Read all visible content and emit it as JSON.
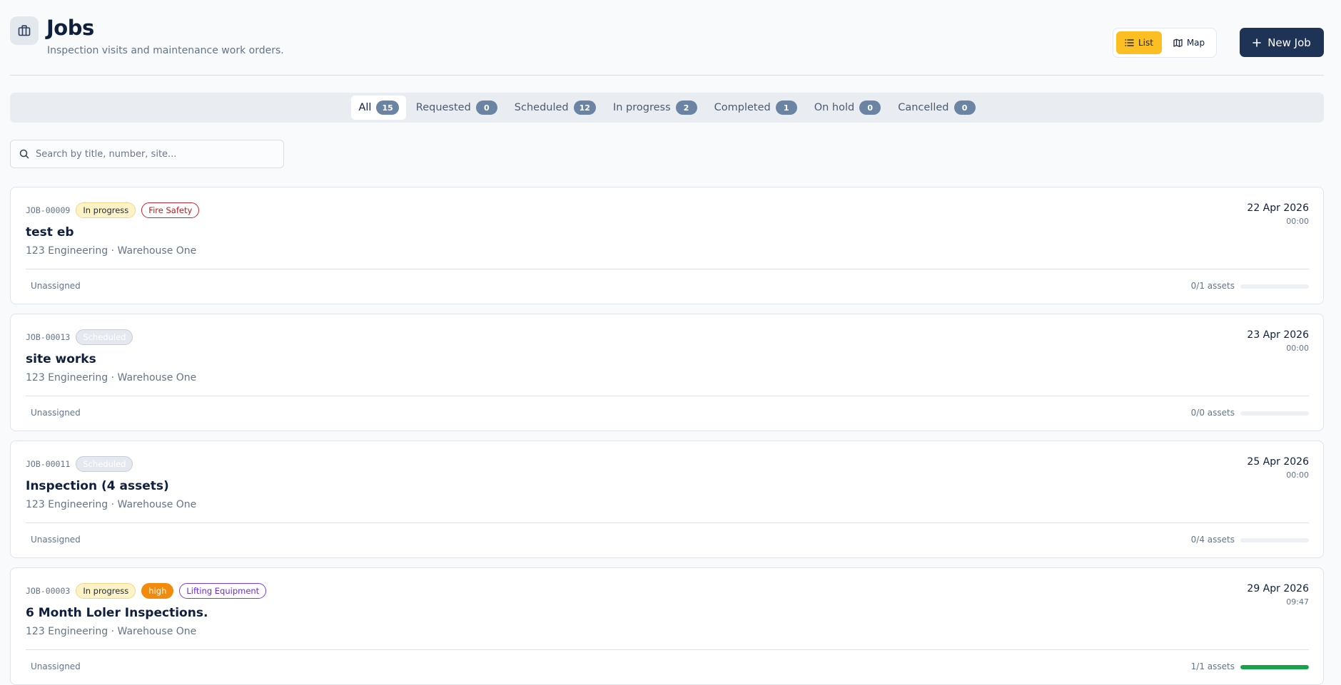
{
  "header": {
    "title": "Jobs",
    "subtitle": "Inspection visits and maintenance work orders.",
    "icon": "briefcase-icon"
  },
  "view_toggle": {
    "list_label": "List",
    "map_label": "Map",
    "active": "list",
    "accent": "#fbbf24"
  },
  "new_job_label": "New Job",
  "tabs": [
    {
      "label": "All",
      "count": "15",
      "active": true
    },
    {
      "label": "Requested",
      "count": "0"
    },
    {
      "label": "Scheduled",
      "count": "12"
    },
    {
      "label": "In progress",
      "count": "2"
    },
    {
      "label": "Completed",
      "count": "1"
    },
    {
      "label": "On hold",
      "count": "0"
    },
    {
      "label": "Cancelled",
      "count": "0"
    }
  ],
  "search": {
    "placeholder": "Search by title, number, site..."
  },
  "jobs": [
    {
      "number": "JOB-00009",
      "badges": [
        {
          "label": "In progress",
          "kind": "inprogress"
        },
        {
          "label": "Fire Safety",
          "kind": "firesafety"
        }
      ],
      "title": "test eb",
      "site": "123 Engineering · Warehouse One",
      "date": "22 Apr 2026",
      "time": "00:00",
      "assignee": "Unassigned",
      "assets": "0/1 assets",
      "progress": 0
    },
    {
      "number": "JOB-00013",
      "badges": [
        {
          "label": "Scheduled",
          "kind": "scheduled"
        }
      ],
      "title": "site works",
      "site": "123 Engineering · Warehouse One",
      "date": "23 Apr 2026",
      "time": "00:00",
      "assignee": "Unassigned",
      "assets": "0/0 assets",
      "progress": 0
    },
    {
      "number": "JOB-00011",
      "badges": [
        {
          "label": "Scheduled",
          "kind": "scheduled"
        }
      ],
      "title": "Inspection (4 assets)",
      "site": "123 Engineering · Warehouse One",
      "date": "25 Apr 2026",
      "time": "00:00",
      "assignee": "Unassigned",
      "assets": "0/4 assets",
      "progress": 0
    },
    {
      "number": "JOB-00003",
      "badges": [
        {
          "label": "In progress",
          "kind": "inprogress"
        },
        {
          "label": "high",
          "kind": "high"
        },
        {
          "label": "Lifting Equipment",
          "kind": "lifting"
        }
      ],
      "title": "6 Month Loler Inspections.",
      "site": "123 Engineering · Warehouse One",
      "date": "29 Apr 2026",
      "time": "09:47",
      "assignee": "Unassigned",
      "assets": "1/1 assets",
      "progress": 1
    }
  ]
}
